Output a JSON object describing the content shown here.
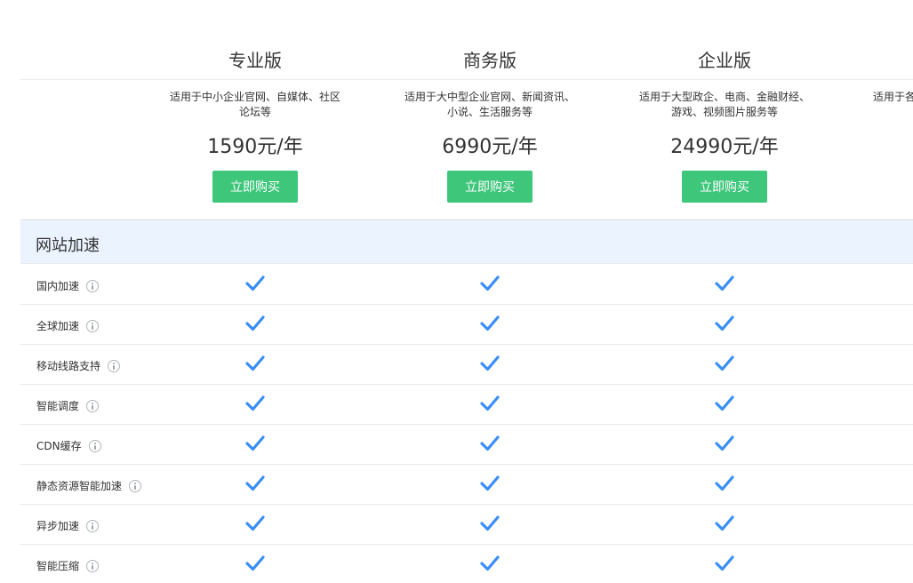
{
  "plans": [
    {
      "name": "专业版",
      "description": "适用于中小企业官网、自媒体、社区\n论坛等",
      "price": "1590元/年",
      "buy_label": "立即购买"
    },
    {
      "name": "商务版",
      "description": "适用于大中型企业官网、新闻资讯、\n小说、生活服务等",
      "price": "6990元/年",
      "buy_label": "立即购买"
    },
    {
      "name": "企业版",
      "description": "适用于大型政企、电商、金融财经、\n游戏、视频图片服务等",
      "price": "24990元/年",
      "buy_label": "立即购买"
    },
    {
      "description": "适用于各"
    }
  ],
  "section": {
    "title": "网站加速"
  },
  "features": [
    {
      "label": "国内加速"
    },
    {
      "label": "全球加速"
    },
    {
      "label": "移动线路支持"
    },
    {
      "label": "智能调度"
    },
    {
      "label": "CDN缓存"
    },
    {
      "label": "静态资源智能加速"
    },
    {
      "label": "异步加速"
    },
    {
      "label": "智能压缩"
    }
  ],
  "colors": {
    "buy_button": "#3ec67b",
    "check": "#3a8ef6",
    "section_bg": "#eaf3fe"
  },
  "icons": {
    "feature_info": "info-circle-icon",
    "included": "checkmark-icon"
  }
}
